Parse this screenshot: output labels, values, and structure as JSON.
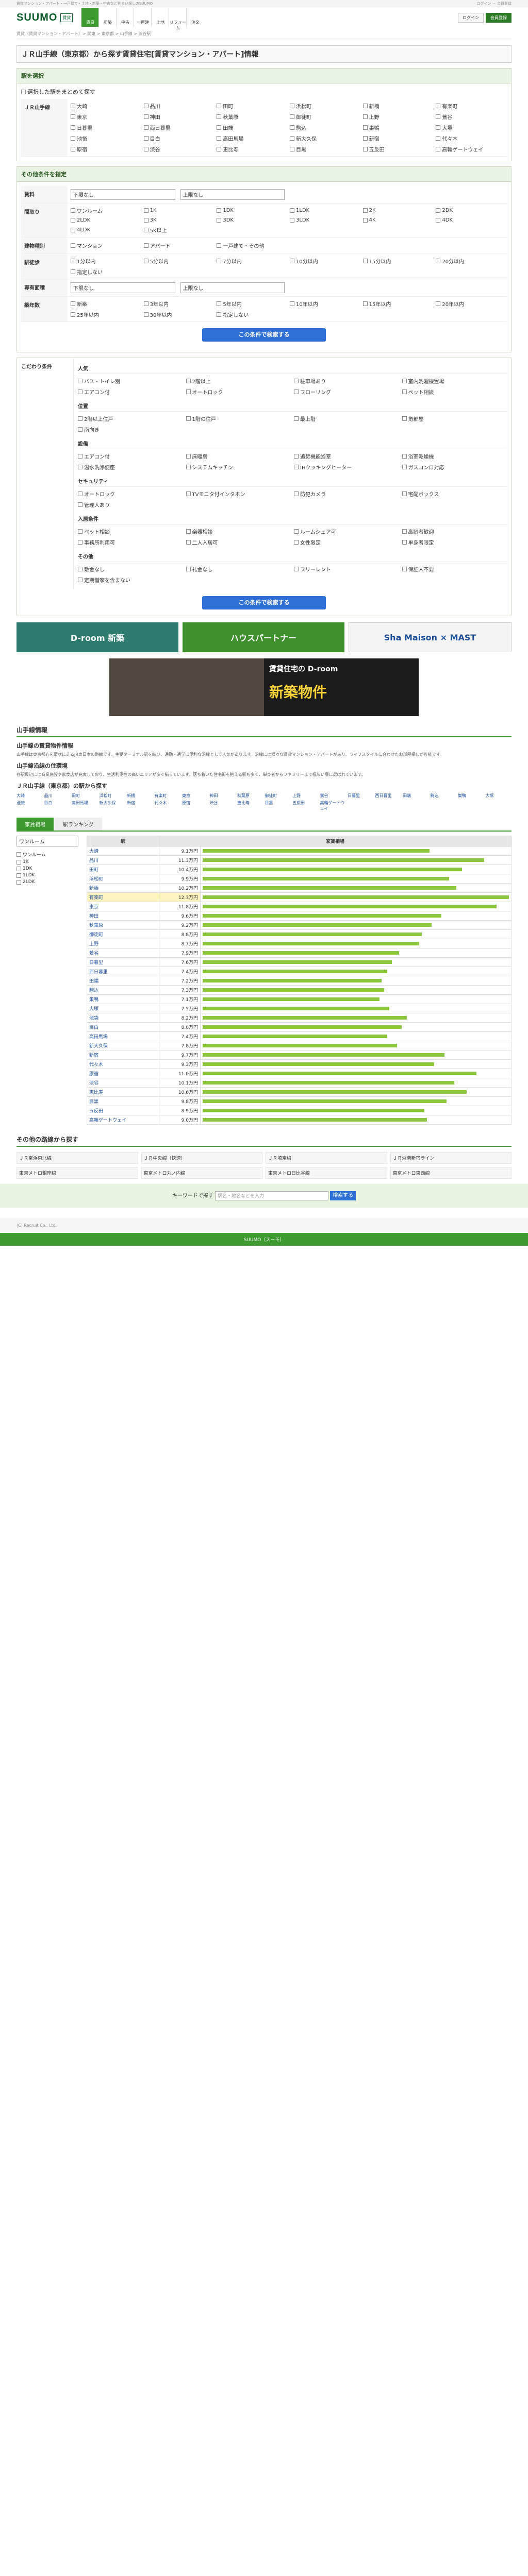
{
  "topbar": {
    "left": "賃貸マンション・アパート・一戸建て・土地・新築・中古など住まい探しのSUUMO",
    "right": "ログイン ・ 会員登録"
  },
  "header": {
    "logo": "SUUMO",
    "logo_sub": "賃貸",
    "nav": [
      "賃貸",
      "新築",
      "中古",
      "一戸建",
      "土地",
      "リフォーム",
      "注文"
    ],
    "login": "ログイン",
    "register": "会員登録"
  },
  "breadcrumb": "賃貸（賃貸マンション・アパート）> 関東 > 東京都 > 山手線 > 渋谷駅",
  "page_title": "ＪＲ山手線（東京都）から探す賃貸住宅[賃貸マンション・アパート]情報",
  "route": {
    "title": "駅を選択",
    "check_all": "選択した駅をまとめて探す",
    "line": "ＪＲ山手線",
    "stations": [
      "大崎",
      "品川",
      "田町",
      "浜松町",
      "新橋",
      "有楽町",
      "東京",
      "神田",
      "秋葉原",
      "御徒町",
      "上野",
      "鶯谷",
      "日暮里",
      "西日暮里",
      "田端",
      "駒込",
      "巣鴨",
      "大塚",
      "池袋",
      "目白",
      "高田馬場",
      "新大久保",
      "新宿",
      "代々木",
      "原宿",
      "渋谷",
      "恵比寿",
      "目黒",
      "五反田",
      "高輪ゲートウェイ"
    ]
  },
  "cond": {
    "title": "その他条件を指定",
    "rent": "賃料",
    "rent_min": "下限なし",
    "rent_max": "上限なし",
    "madori": "間取り",
    "madori_opts": [
      "ワンルーム",
      "1K",
      "1DK",
      "1LDK",
      "2K",
      "2DK",
      "2LDK",
      "3K",
      "3DK",
      "3LDK",
      "4K",
      "4DK",
      "4LDK",
      "5K以上"
    ],
    "kind": "建物種別",
    "kind_opts": [
      "マンション",
      "アパート",
      "一戸建て・その他"
    ],
    "walk": "駅徒歩",
    "walk_opts": [
      "1分以内",
      "5分以内",
      "7分以内",
      "10分以内",
      "15分以内",
      "20分以内",
      "指定しない"
    ],
    "area": "専有面積",
    "area_min": "下限なし",
    "area_max": "上限なし",
    "age": "築年数",
    "age_opts": [
      "新築",
      "3年以内",
      "5年以内",
      "10年以内",
      "15年以内",
      "20年以内",
      "25年以内",
      "30年以内",
      "指定しない"
    ],
    "submit": "この条件で検索する"
  },
  "detail": {
    "side_label": "こだわり条件",
    "groups": [
      {
        "h": "人気",
        "opts": [
          "バス・トイレ別",
          "2階以上",
          "駐車場あり",
          "室内洗濯機置場",
          "エアコン付",
          "オートロック",
          "フローリング",
          "ペット相談"
        ]
      },
      {
        "h": "位置",
        "opts": [
          "2階以上住戸",
          "1階の住戸",
          "最上階",
          "角部屋",
          "南向き"
        ]
      },
      {
        "h": "設備",
        "opts": [
          "エアコン付",
          "床暖房",
          "追焚機能浴室",
          "浴室乾燥機",
          "温水洗浄便座",
          "システムキッチン",
          "IHクッキングヒーター",
          "ガスコンロ対応"
        ]
      },
      {
        "h": "セキュリティ",
        "opts": [
          "オートロック",
          "TVモニタ付インタホン",
          "防犯カメラ",
          "宅配ボックス",
          "管理人あり"
        ]
      },
      {
        "h": "入居条件",
        "opts": [
          "ペット相談",
          "楽器相談",
          "ルームシェア可",
          "高齢者歓迎",
          "事務所利用可",
          "二人入居可",
          "女性限定",
          "単身者限定"
        ]
      },
      {
        "h": "その他",
        "opts": [
          "敷金なし",
          "礼金なし",
          "フリーレント",
          "保証人不要",
          "定期借家を含まない"
        ]
      }
    ],
    "submit": "この条件で検索する"
  },
  "banners": {
    "b1": "D-room 新築",
    "b2": "ハウスパートナー",
    "b3": "Sha Maison × MAST"
  },
  "bigbanner": {
    "title": "賃貸住宅の D-room",
    "sub": "新築物件"
  },
  "info": {
    "title": "山手線情報",
    "h1": "山手線の賃貸物件情報",
    "p1": "山手線は東京都心を環状に走るJR東日本の路線です。主要ターミナル駅を結び、通勤・通学に便利な沿線として人気があります。沿線には様々な賃貸マンション・アパートがあり、ライフスタイルに合わせたお部屋探しが可能です。",
    "h2": "山手線沿線の住環境",
    "p2": "各駅周辺には商業施設や飲食店が充実しており、生活利便性の高いエリアが多く揃っています。落ち着いた住宅街を抱える駅も多く、単身者からファミリーまで幅広い層に選ばれています。"
  },
  "areas_title": "ＪＲ山手線（東京都）の駅から探す",
  "tabs": [
    "家賃相場",
    "駅ランキング"
  ],
  "rank": {
    "side_select": "ワンルーム",
    "side_opts": [
      "ワンルーム",
      "1K",
      "1DK",
      "1LDK",
      "2LDK"
    ],
    "head": [
      "駅",
      "家賃相場"
    ],
    "rows": [
      {
        "st": "大崎",
        "rent": "9.1万円"
      },
      {
        "st": "品川",
        "rent": "11.3万円"
      },
      {
        "st": "田町",
        "rent": "10.4万円"
      },
      {
        "st": "浜松町",
        "rent": "9.9万円"
      },
      {
        "st": "新橋",
        "rent": "10.2万円"
      },
      {
        "st": "有楽町",
        "rent": "12.3万円"
      },
      {
        "st": "東京",
        "rent": "11.8万円"
      },
      {
        "st": "神田",
        "rent": "9.6万円"
      },
      {
        "st": "秋葉原",
        "rent": "9.2万円"
      },
      {
        "st": "御徒町",
        "rent": "8.8万円"
      },
      {
        "st": "上野",
        "rent": "8.7万円"
      },
      {
        "st": "鶯谷",
        "rent": "7.9万円"
      },
      {
        "st": "日暮里",
        "rent": "7.6万円"
      },
      {
        "st": "西日暮里",
        "rent": "7.4万円"
      },
      {
        "st": "田端",
        "rent": "7.2万円"
      },
      {
        "st": "駒込",
        "rent": "7.3万円"
      },
      {
        "st": "巣鴨",
        "rent": "7.1万円"
      },
      {
        "st": "大塚",
        "rent": "7.5万円"
      },
      {
        "st": "池袋",
        "rent": "8.2万円"
      },
      {
        "st": "目白",
        "rent": "8.0万円"
      },
      {
        "st": "高田馬場",
        "rent": "7.4万円"
      },
      {
        "st": "新大久保",
        "rent": "7.8万円"
      },
      {
        "st": "新宿",
        "rent": "9.7万円"
      },
      {
        "st": "代々木",
        "rent": "9.3万円"
      },
      {
        "st": "原宿",
        "rent": "11.0万円"
      },
      {
        "st": "渋谷",
        "rent": "10.1万円"
      },
      {
        "st": "恵比寿",
        "rent": "10.6万円"
      },
      {
        "st": "目黒",
        "rent": "9.8万円"
      },
      {
        "st": "五反田",
        "rent": "8.9万円"
      },
      {
        "st": "高輪ゲートウェイ",
        "rent": "9.0万円"
      }
    ],
    "highlight_index": 5,
    "max": 12.3
  },
  "links_title": "その他の路線から探す",
  "links": [
    "ＪＲ京浜東北線",
    "ＪＲ中央線（快速）",
    "ＪＲ埼京線",
    "ＪＲ湘南新宿ライン",
    "東京メトロ銀座線",
    "東京メトロ丸ノ内線",
    "東京メトロ日比谷線",
    "東京メトロ東西線"
  ],
  "search": {
    "label": "キーワードで探す",
    "placeholder": "駅名・地名などを入力",
    "go": "検索する"
  },
  "footer": {
    "copy": "(C) Recruit Co., Ltd.",
    "bottom": "SUUMO（スーモ）"
  }
}
